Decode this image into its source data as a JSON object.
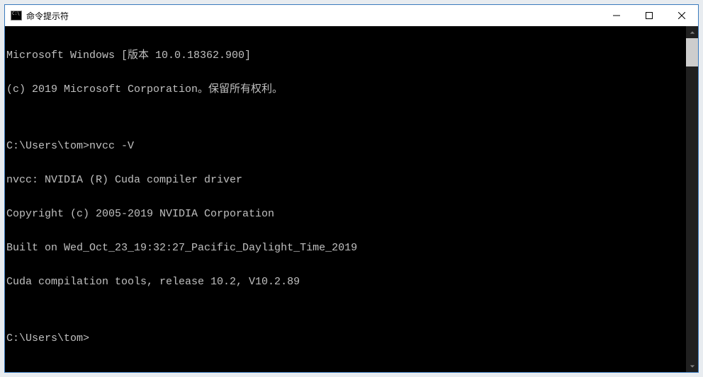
{
  "window": {
    "title": "命令提示符"
  },
  "terminal": {
    "lines": [
      "Microsoft Windows [版本 10.0.18362.900]",
      "(c) 2019 Microsoft Corporation。保留所有权利。",
      "",
      "C:\\Users\\tom>nvcc -V",
      "nvcc: NVIDIA (R) Cuda compiler driver",
      "Copyright (c) 2005-2019 NVIDIA Corporation",
      "Built on Wed_Oct_23_19:32:27_Pacific_Daylight_Time_2019",
      "Cuda compilation tools, release 10.2, V10.2.89",
      "",
      "C:\\Users\\tom>"
    ]
  }
}
